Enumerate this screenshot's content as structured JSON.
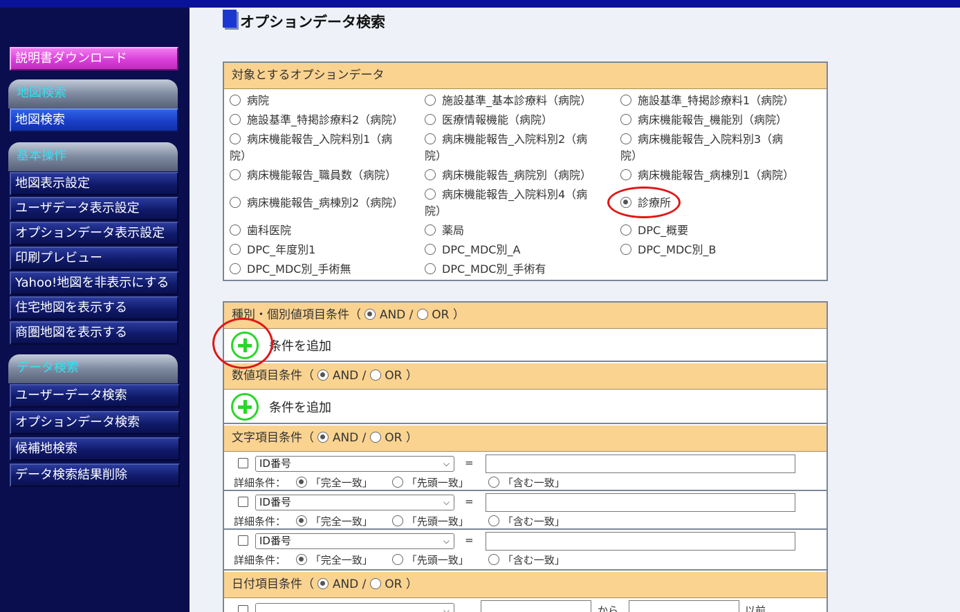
{
  "page": {
    "title": "オプションデータ検索"
  },
  "sidebar": {
    "download": "説明書ダウンロード",
    "sections": [
      {
        "heading": "地図検索",
        "items": [
          "地図検索"
        ]
      },
      {
        "heading": "基本操作",
        "items": [
          "地図表示設定",
          "ユーザデータ表示設定",
          "オプションデータ表示設定",
          "印刷プレビュー",
          "Yahoo!地図を非表示にする",
          "住宅地図を表示する",
          "商圏地図を表示する"
        ]
      },
      {
        "heading": "データ検索",
        "items": [
          "ユーザーデータ検索",
          "オプションデータ検索",
          "候補地検索",
          "データ検索結果削除"
        ]
      }
    ]
  },
  "target": {
    "heading": "対象とするオプションデータ",
    "options": [
      "病院",
      "施設基準_基本診療料（病院）",
      "施設基準_特掲診療料1（病院）",
      "施設基準_特掲診療料2（病院）",
      "医療情報機能（病院）",
      "病床機能報告_機能別（病院）",
      "病床機能報告_入院料別1（病",
      "院）",
      "病床機能報告_入院料別2（病",
      "院）",
      "病床機能報告_入院料別3（病",
      "院）",
      "病床機能報告_職員数（病院）",
      "病床機能報告_病院別（病院）",
      "病床機能報告_病棟別1（病院）",
      "病床機能報告_病棟別2（病院）",
      "病床機能報告_入院料別4（病",
      "院）",
      "診療所",
      "歯科医院",
      "薬局",
      "DPC_概要",
      "DPC_年度別1",
      "DPC_MDC別_A",
      "DPC_MDC別_B",
      "DPC_MDC別_手術無",
      "DPC_MDC別_手術有"
    ],
    "selected": "診療所"
  },
  "conditions": {
    "and": "AND",
    "slash": "/",
    "or": "OR",
    "open": "（",
    "close": "）",
    "add": "条件を追加",
    "category": {
      "heading": "種別・個別値項目条件"
    },
    "numeric": {
      "heading": "数値項目条件"
    },
    "text": {
      "heading": "文字項目条件",
      "rows": [
        {
          "field": "ID番号",
          "eq": "=",
          "detail": "詳細条件：",
          "m1": "「完全一致」",
          "m2": "「先頭一致」",
          "m3": "「含む一致」"
        },
        {
          "field": "ID番号",
          "eq": "=",
          "detail": "詳細条件：",
          "m1": "「完全一致」",
          "m2": "「先頭一致」",
          "m3": "「含む一致」"
        },
        {
          "field": "ID番号",
          "eq": "=",
          "detail": "詳細条件：",
          "m1": "「完全一致」",
          "m2": "「先頭一致」",
          "m3": "「含む一致」"
        }
      ]
    },
    "date": {
      "heading": "日付項目条件",
      "from": "から",
      "before": "以前"
    }
  },
  "colors": {
    "panel_header": "#fad390",
    "sidebar_bg": "#0a0e4e",
    "topbar": "#0a129a",
    "plus": "#29d629",
    "annotation": "#e01616"
  }
}
